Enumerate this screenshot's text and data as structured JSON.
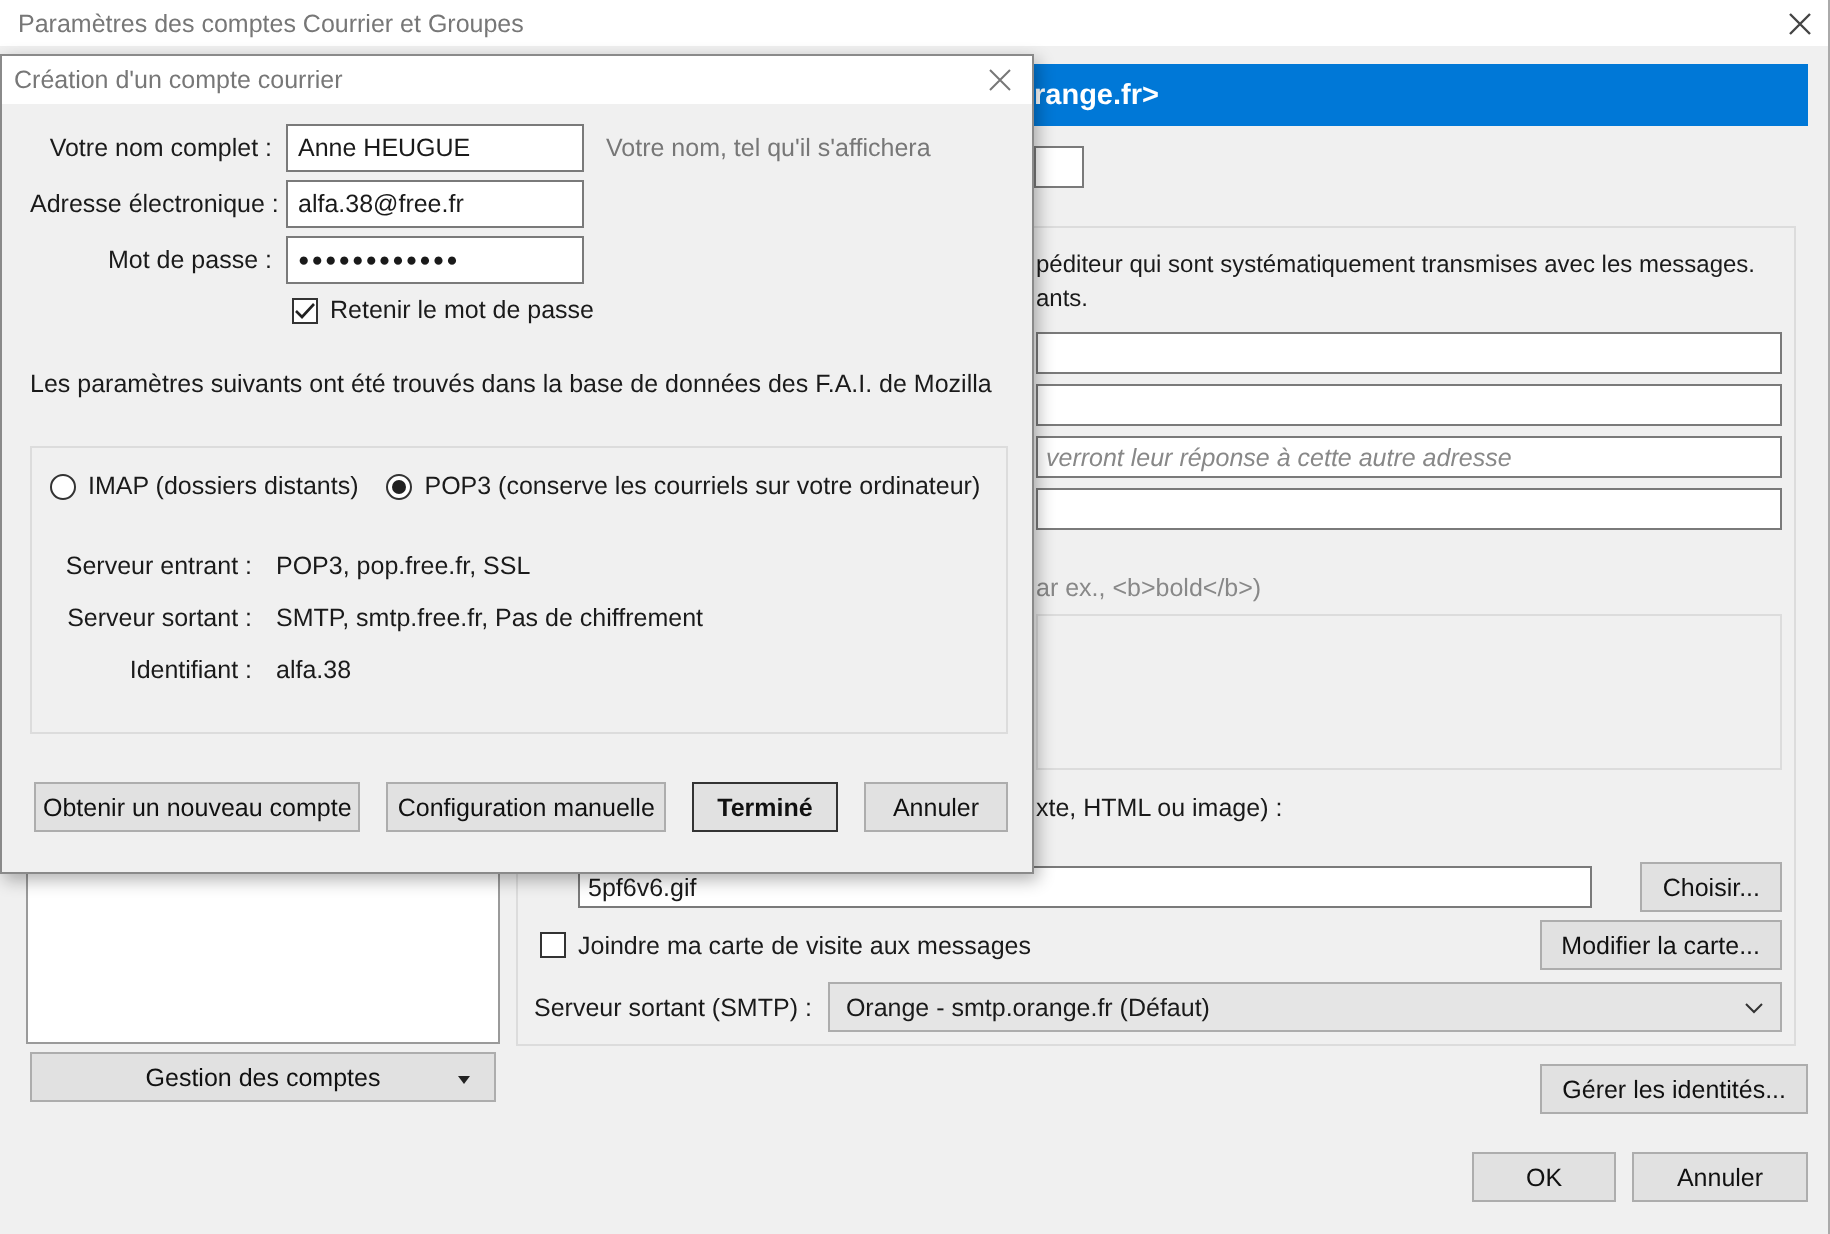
{
  "window": {
    "title": "Paramètres des comptes Courrier et Groupes"
  },
  "accounts_panel": {
    "manage_button": "Gestion des comptes"
  },
  "account_settings": {
    "header": "range.fr>",
    "identity_text": [
      "péditeur qui sont systématiquement transmises avec les messages.",
      "ants."
    ],
    "reply_to_field": {
      "placeholder": "verront leur réponse à cette autre adresse"
    },
    "html_hint": "ar ex., <b>bold</b>)",
    "signature_file_label": "xte, HTML ou image) :",
    "signature_file": {
      "value": "5pf6v6.gif"
    },
    "choose_button": "Choisir...",
    "attach_vcard": {
      "label": "Joindre ma carte de visite aux messages",
      "checked": false
    },
    "edit_card_button": "Modifier la carte...",
    "smtp": {
      "label": "Serveur sortant (SMTP) :",
      "value": "Orange - smtp.orange.fr (Défaut)"
    },
    "manage_identities_button": "Gérer les identités...",
    "buttons": [
      "OK",
      "Annuler"
    ]
  },
  "dialog": {
    "title": "Création d'un compte courrier",
    "fields": [
      {
        "label": "Votre nom complet :",
        "value": "Anne HEUGUE",
        "kind": "text",
        "hint": "Votre nom, tel qu'il s'affichera"
      },
      {
        "label": "Adresse électronique :",
        "value": "alfa.38@free.fr",
        "kind": "text"
      },
      {
        "label": "Mot de passe :",
        "value": "●●●●●●●●●●●●",
        "kind": "password"
      }
    ],
    "remember_password": {
      "label": "Retenir le mot de passe",
      "checked": true
    },
    "notice": "Les paramètres suivants ont été trouvés dans la base de données des F.A.I. de Mozilla",
    "protocols": [
      {
        "label": "IMAP (dossiers distants)",
        "selected": false
      },
      {
        "label": "POP3 (conserve les courriels sur votre ordinateur)",
        "selected": true
      }
    ],
    "server_info": [
      {
        "label": "Serveur entrant :",
        "value": "POP3, pop.free.fr, SSL"
      },
      {
        "label": "Serveur sortant :",
        "value": "SMTP, smtp.free.fr, Pas de chiffrement"
      },
      {
        "label": "Identifiant :",
        "value": "alfa.38"
      }
    ],
    "buttons": [
      {
        "label": "Obtenir un nouveau compte",
        "default": false
      },
      {
        "label": "Configuration manuelle",
        "default": false
      },
      {
        "label": "Terminé",
        "default": true
      },
      {
        "label": "Annuler",
        "default": false
      }
    ]
  }
}
